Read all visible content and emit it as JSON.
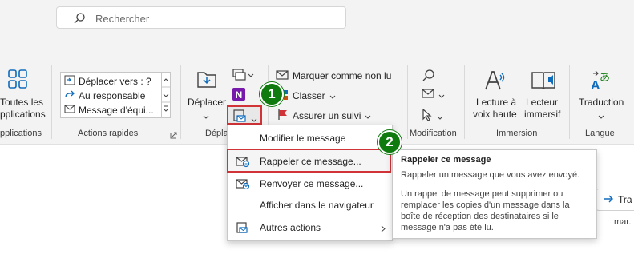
{
  "search": {
    "placeholder": "Rechercher"
  },
  "ribbon": {
    "all_apps": {
      "label_line1": "Toutes les",
      "label_line2": "pplications",
      "group": "pplications"
    },
    "quick_steps": {
      "group": "Actions rapides",
      "items": [
        "Déplacer vers : ?",
        "Au responsable",
        "Message d'équi..."
      ]
    },
    "move": {
      "label": "Déplacer",
      "group": "Déplac"
    },
    "tags": {
      "mark_unread": "Marquer comme non lu",
      "classify": "Classer",
      "follow_up": "Assurer un suivi"
    },
    "modification": {
      "group": "Modification"
    },
    "immersion": {
      "group": "Immersion",
      "read_aloud_l1": "Lecture à",
      "read_aloud_l2": "voix haute",
      "reader_l1": "Lecteur",
      "reader_l2": "immersif"
    },
    "language": {
      "group": "Langue",
      "translate": "Traduction"
    }
  },
  "menu": {
    "items": [
      {
        "label": "Modifier le message",
        "icon": "none"
      },
      {
        "label": "Rappeler ce message...",
        "icon": "recall-icon"
      },
      {
        "label": "Renvoyer ce message...",
        "icon": "resend-icon"
      },
      {
        "label": "Afficher dans le navigateur",
        "icon": "none"
      },
      {
        "label": "Autres actions",
        "icon": "actions-icon"
      }
    ]
  },
  "badges": {
    "one": "1",
    "two": "2"
  },
  "tooltip": {
    "title": "Rappeler ce message",
    "line1": "Rappeler un message que vous avez envoyé.",
    "desc": "Un rappel de message peut supprimer ou\nremplacer les copies d'un message dans la\nboîte de réception des destinataires si le\nmessage n'a pas été lu."
  },
  "content": {
    "tra_label": "Tra",
    "date": "mar."
  },
  "colors": {
    "accent": "#0f6cbd",
    "badge": "#0f7b0f",
    "highlight": "#d13438",
    "onenote": "#7719aa",
    "flag": "#d13438"
  }
}
